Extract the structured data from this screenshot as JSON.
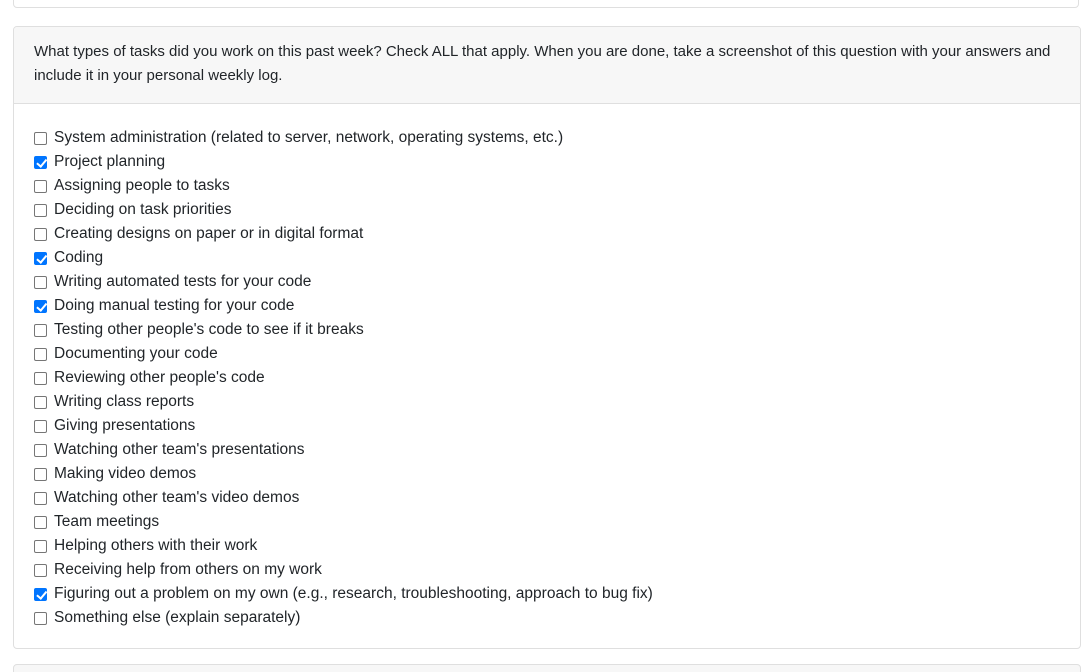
{
  "question": {
    "text": "What types of tasks did you work on this past week? Check ALL that apply. When you are done, take a screenshot of this question with your answers and include it in your personal weekly log."
  },
  "options": [
    {
      "label": "System administration (related to server, network, operating systems, etc.)",
      "checked": false
    },
    {
      "label": "Project planning",
      "checked": true
    },
    {
      "label": "Assigning people to tasks",
      "checked": false
    },
    {
      "label": "Deciding on task priorities",
      "checked": false
    },
    {
      "label": "Creating designs on paper or in digital format",
      "checked": false
    },
    {
      "label": "Coding",
      "checked": true
    },
    {
      "label": "Writing automated tests for your code",
      "checked": false
    },
    {
      "label": "Doing manual testing for your code",
      "checked": true
    },
    {
      "label": "Testing other people's code to see if it breaks",
      "checked": false
    },
    {
      "label": "Documenting your code",
      "checked": false
    },
    {
      "label": "Reviewing other people's code",
      "checked": false
    },
    {
      "label": "Writing class reports",
      "checked": false
    },
    {
      "label": "Giving presentations",
      "checked": false
    },
    {
      "label": "Watching other team's presentations",
      "checked": false
    },
    {
      "label": "Making video demos",
      "checked": false
    },
    {
      "label": "Watching other team's video demos",
      "checked": false
    },
    {
      "label": "Team meetings",
      "checked": false
    },
    {
      "label": "Helping others with their work",
      "checked": false
    },
    {
      "label": "Receiving help from others on my work",
      "checked": false
    },
    {
      "label": "Figuring out a problem on my own (e.g., research, troubleshooting, approach to bug fix)",
      "checked": true
    },
    {
      "label": "Something else (explain separately)",
      "checked": false
    }
  ],
  "colors": {
    "checkbox_checked": "#0075ff",
    "header_background": "#f7f7f7",
    "border": "#dfdfdf"
  }
}
